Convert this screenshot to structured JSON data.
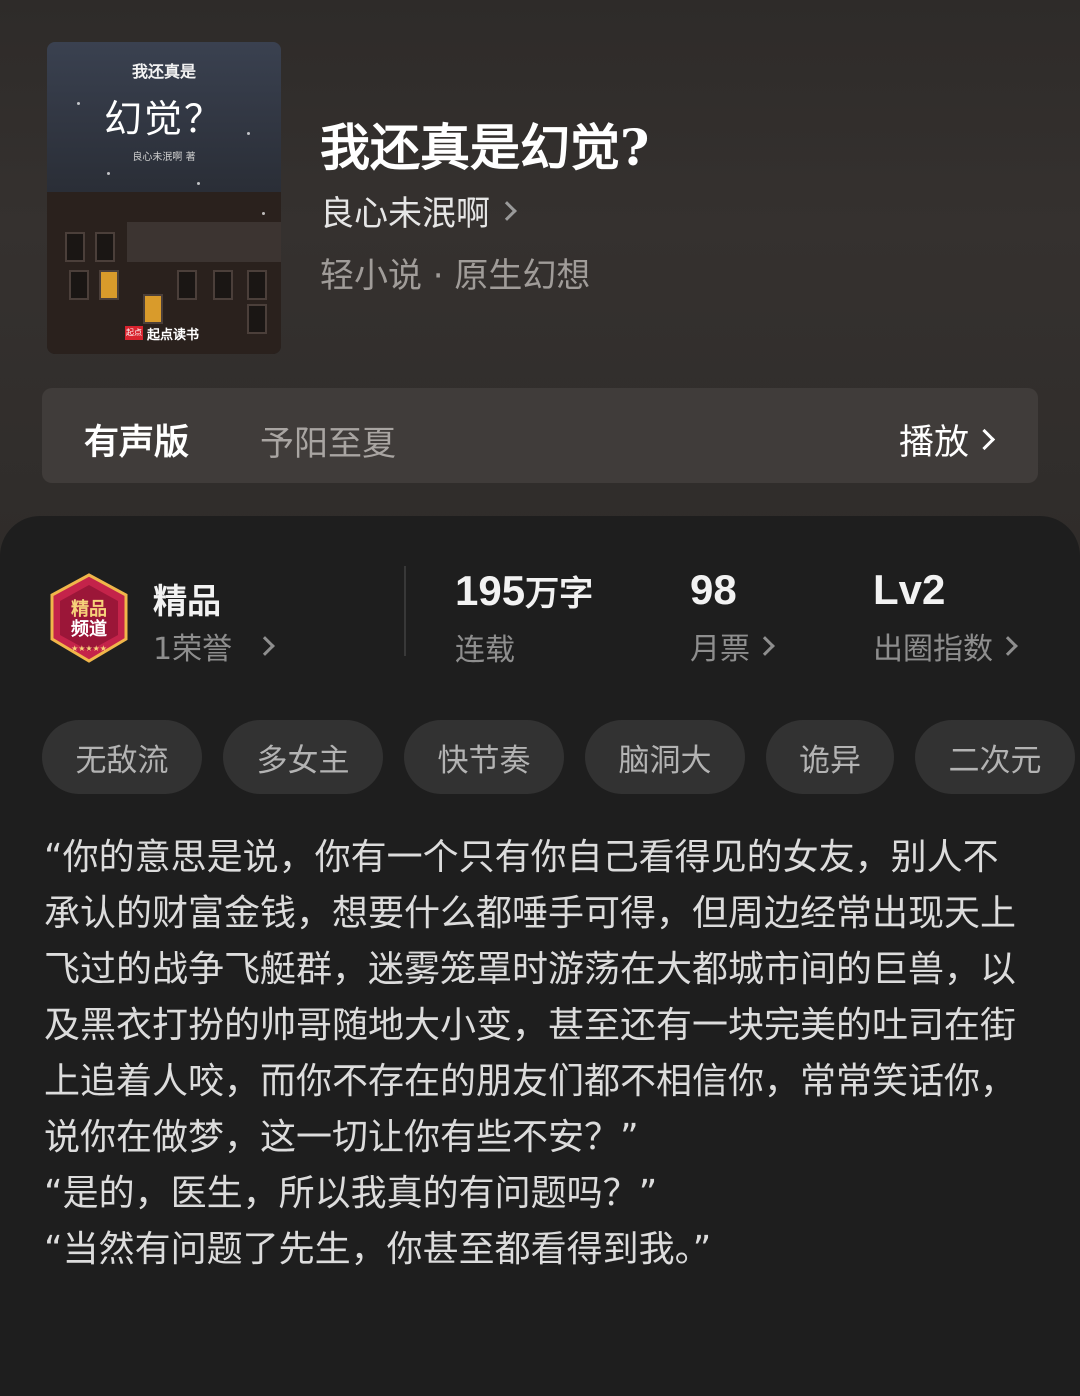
{
  "book": {
    "cover": {
      "title_small": "我还真是",
      "title_big": "幻觉？",
      "author": "良心未泯啊 著",
      "brand_badge": "起点",
      "brand": "起点读书"
    },
    "title": "我还真是幻觉?",
    "author": "良心未泯啊",
    "genre": "轻小说 · 原生幻想"
  },
  "audio": {
    "label": "有声版",
    "narrator": "予阳至夏",
    "play_label": "播放"
  },
  "stats": {
    "quality": {
      "title": "精品",
      "sub": "1荣誉",
      "badge_icon": "jingpin-channel-badge-icon"
    },
    "words": {
      "value": "195",
      "unit": "万字",
      "label": "连载"
    },
    "tickets": {
      "value": "98",
      "label": "月票"
    },
    "index": {
      "value": "Lv2",
      "label": "出圈指数"
    }
  },
  "tags": [
    "无敌流",
    "多女主",
    "快节奏",
    "脑洞大",
    "诡异",
    "二次元"
  ],
  "intro": [
    "“你的意思是说，你有一个只有你自己看得见的女友，别人不承认的财富金钱，想要什么都唾手可得，但周边经常出现天上飞过的战争飞艇群，迷雾笼罩时游荡在大都城市间的巨兽，以及黑衣打扮的帅哥随地大小变，甚至还有一块完美的吐司在街上追着人咬，而你不存在的朋友们都不相信你，常常笑话你，说你在做梦，这一切让你有些不安？”",
    "“是的，医生，所以我真的有问题吗？”",
    "“当然有问题了先生，你甚至都看得到我。”"
  ],
  "colors": {
    "background": "#1e1e1e",
    "top_background": "#33302e",
    "tag_bg": "#323232",
    "badge_red": "#c4234a"
  }
}
